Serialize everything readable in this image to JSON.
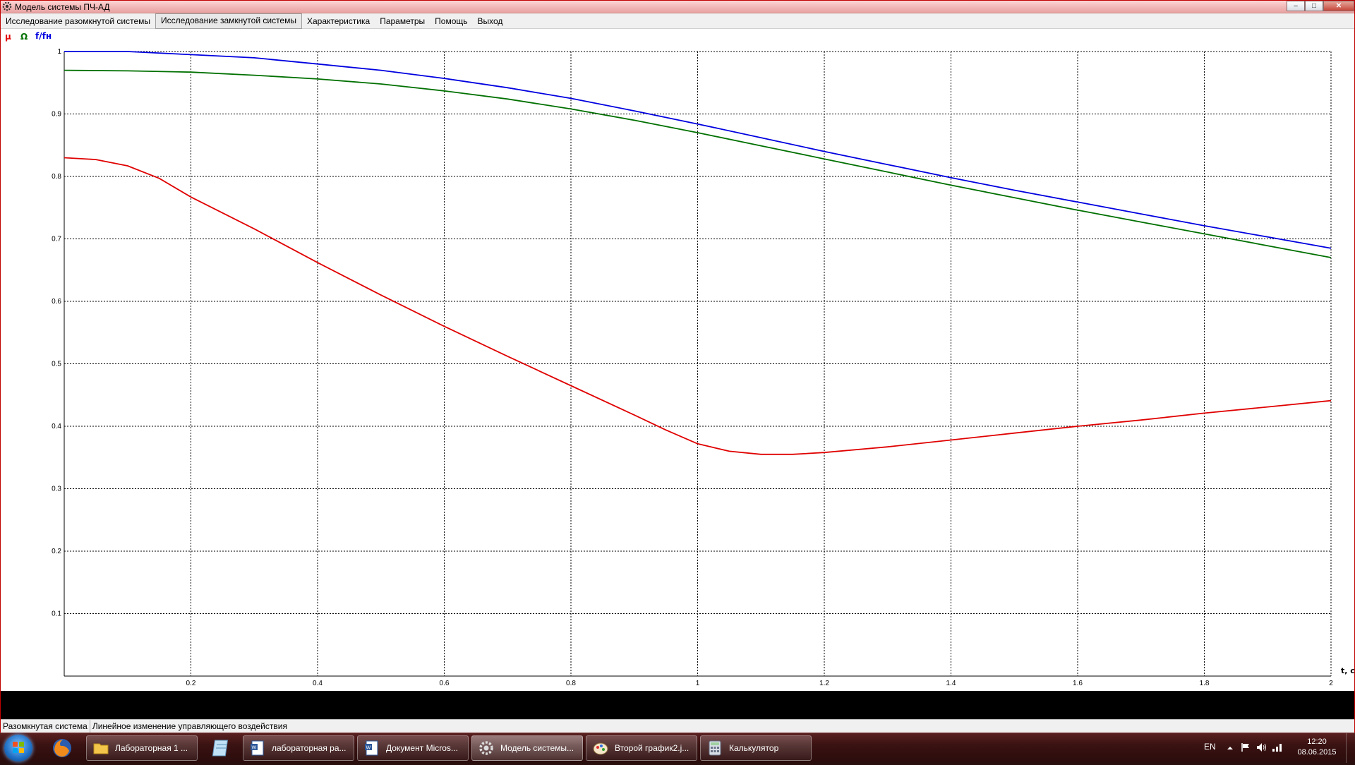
{
  "window": {
    "title": "Модель системы ПЧ-АД",
    "controls": [
      "–",
      "□",
      "✕"
    ]
  },
  "menu": {
    "items": [
      {
        "label": "Исследование разомкнутой системы",
        "active": false
      },
      {
        "label": "Исследование замкнутой системы",
        "active": true
      },
      {
        "label": "Характеристика",
        "active": false
      },
      {
        "label": "Параметры",
        "active": false
      },
      {
        "label": "Помощь",
        "active": false
      },
      {
        "label": "Выход",
        "active": false
      }
    ]
  },
  "legend": {
    "mu": "μ",
    "omega": "Ω",
    "freq": "f/fн"
  },
  "colors": {
    "mu": "#e00000",
    "omega": "#007000",
    "freq": "#0000e0",
    "grid": "#000000",
    "titlebar_accent": "#c00000"
  },
  "chart_data": {
    "type": "line",
    "xlabel": "t, c",
    "ylabel": "",
    "xlim": [
      0,
      2
    ],
    "ylim": [
      0,
      1
    ],
    "x_ticks": [
      "0.2",
      "0.4",
      "0.6",
      "0.8",
      "1",
      "1.2",
      "1.4",
      "1.6",
      "1.8",
      "2"
    ],
    "y_ticks": [
      "0.1",
      "0.2",
      "0.3",
      "0.4",
      "0.5",
      "0.6",
      "0.7",
      "0.8",
      "0.9",
      "1"
    ],
    "grid": true,
    "legend_position": "top-left",
    "series": [
      {
        "name": "f/fн",
        "color": "#0000e0",
        "x": [
          0,
          0.1,
          0.2,
          0.3,
          0.4,
          0.5,
          0.6,
          0.7,
          0.8,
          0.9,
          1.0,
          1.1,
          1.2,
          1.3,
          1.4,
          1.5,
          1.6,
          1.7,
          1.8,
          1.9,
          2.0
        ],
        "y": [
          1.0,
          1.0,
          0.995,
          0.99,
          0.98,
          0.97,
          0.957,
          0.942,
          0.925,
          0.905,
          0.884,
          0.862,
          0.84,
          0.819,
          0.798,
          0.778,
          0.759,
          0.74,
          0.721,
          0.703,
          0.685
        ]
      },
      {
        "name": "Ω",
        "color": "#007000",
        "x": [
          0,
          0.1,
          0.2,
          0.3,
          0.4,
          0.5,
          0.6,
          0.7,
          0.8,
          0.9,
          1.0,
          1.1,
          1.2,
          1.3,
          1.4,
          1.5,
          1.6,
          1.7,
          1.8,
          1.9,
          2.0
        ],
        "y": [
          0.97,
          0.969,
          0.967,
          0.962,
          0.956,
          0.948,
          0.937,
          0.924,
          0.908,
          0.89,
          0.87,
          0.849,
          0.828,
          0.807,
          0.786,
          0.766,
          0.746,
          0.727,
          0.708,
          0.689,
          0.67
        ]
      },
      {
        "name": "μ",
        "color": "#e00000",
        "x": [
          0,
          0.05,
          0.1,
          0.15,
          0.2,
          0.3,
          0.4,
          0.5,
          0.6,
          0.7,
          0.8,
          0.9,
          0.95,
          1.0,
          1.05,
          1.1,
          1.15,
          1.2,
          1.3,
          1.4,
          1.5,
          1.6,
          1.7,
          1.8,
          1.9,
          2.0
        ],
        "y": [
          0.83,
          0.827,
          0.817,
          0.797,
          0.767,
          0.716,
          0.662,
          0.61,
          0.56,
          0.512,
          0.465,
          0.418,
          0.394,
          0.372,
          0.36,
          0.355,
          0.355,
          0.358,
          0.367,
          0.378,
          0.389,
          0.4,
          0.41,
          0.421,
          0.431,
          0.441
        ]
      }
    ]
  },
  "status": {
    "left": "Разомкнутая система",
    "right": "Линейное изменение управляющего воздействия"
  },
  "taskbar": {
    "buttons": [
      {
        "label": "Лабораторная 1 ...",
        "icon": "folder-icon",
        "active": false
      },
      {
        "label": "лабораторная ра...",
        "icon": "word-document-icon",
        "active": false
      },
      {
        "label": "Документ Micros...",
        "icon": "word-document-icon",
        "active": false
      },
      {
        "label": "Модель системы...",
        "icon": "gear-icon",
        "active": true
      },
      {
        "label": "Второй график2.j...",
        "icon": "paint-icon",
        "active": false
      },
      {
        "label": "Калькулятор",
        "icon": "calculator-icon",
        "active": false
      }
    ],
    "language": "EN",
    "time": "12:20",
    "date": "08.06.2015"
  }
}
